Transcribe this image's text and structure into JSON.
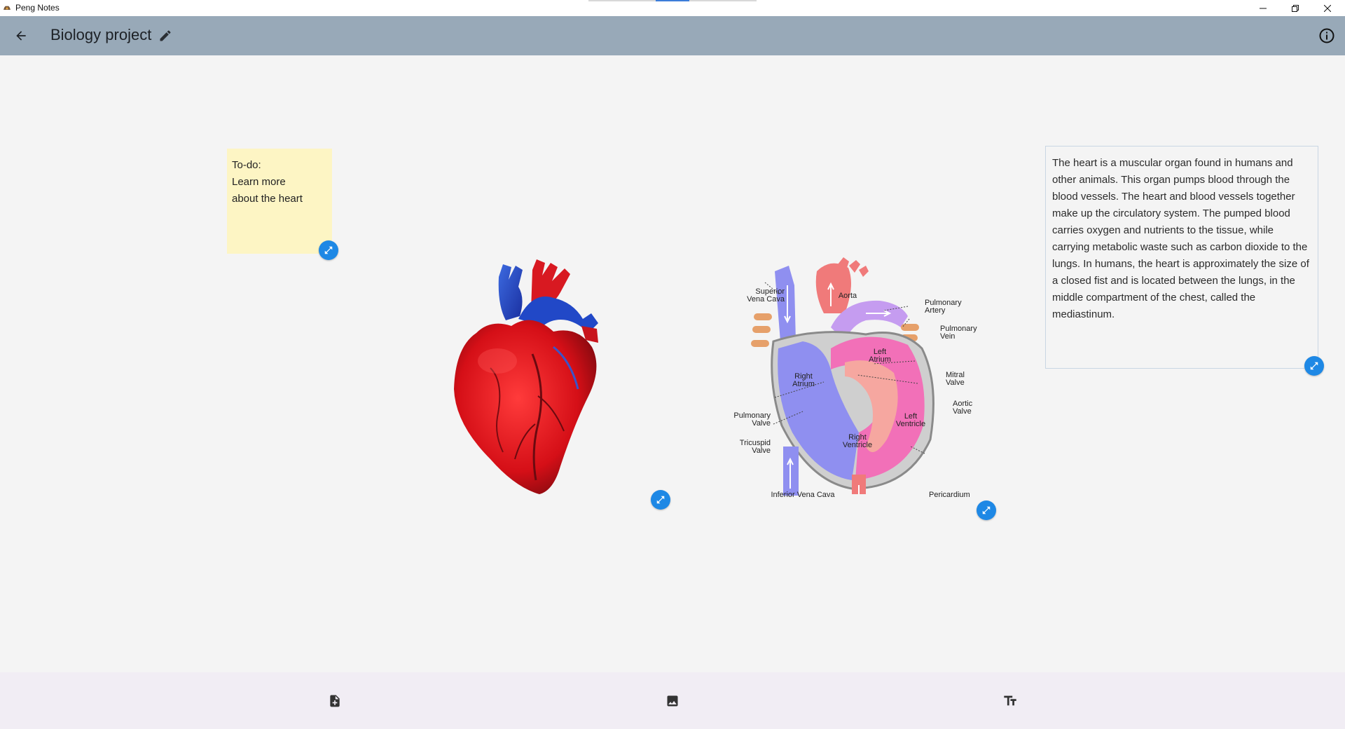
{
  "window": {
    "title": "Peng Notes"
  },
  "appbar": {
    "title": "Biology project"
  },
  "canvas": {
    "sticky_note": {
      "text": "To-do:\nLearn more\nabout the heart"
    },
    "text_box": {
      "text": "The heart is a muscular organ found in humans and other animals. This organ pumps blood through the blood vessels. The heart and blood vessels together make up the circulatory system. The pumped blood carries oxygen and nutrients to the tissue, while carrying metabolic waste such as carbon dioxide to the lungs. In humans, the heart is approximately the size of a closed fist and is located between the lungs, in the middle compartment of the chest, called the mediastinum."
    },
    "diagram_labels": {
      "superior_vena_cava": "Superior\nVena Cava",
      "aorta": "Aorta",
      "pulmonary_artery": "Pulmonary\nArtery",
      "pulmonary_vein": "Pulmonary\nVein",
      "left_atrium": "Left\nAtrium",
      "right_atrium": "Right\nAtrium",
      "mitral_valve": "Mitral\nValve",
      "aortic_valve": "Aortic\nValve",
      "pulmonary_valve": "Pulmonary\nValve",
      "left_ventricle": "Left\nVentricle",
      "right_ventricle": "Right\nVentricle",
      "tricuspid_valve": "Tricuspid\nValve",
      "inferior_vena_cava": "Inferior Vena Cava",
      "pericardium": "Pericardium"
    }
  },
  "colors": {
    "appbar": "#98a9b8",
    "accent": "#1e88e5",
    "sticky": "#fdf5c4",
    "bottombar": "#f1edf4"
  },
  "icons": {
    "back": "arrow-back-icon",
    "edit": "pencil-icon",
    "info": "info-icon",
    "resize": "open-in-full-icon",
    "add_note": "note-add-icon",
    "add_image": "image-icon",
    "add_text": "text-fields-icon"
  }
}
